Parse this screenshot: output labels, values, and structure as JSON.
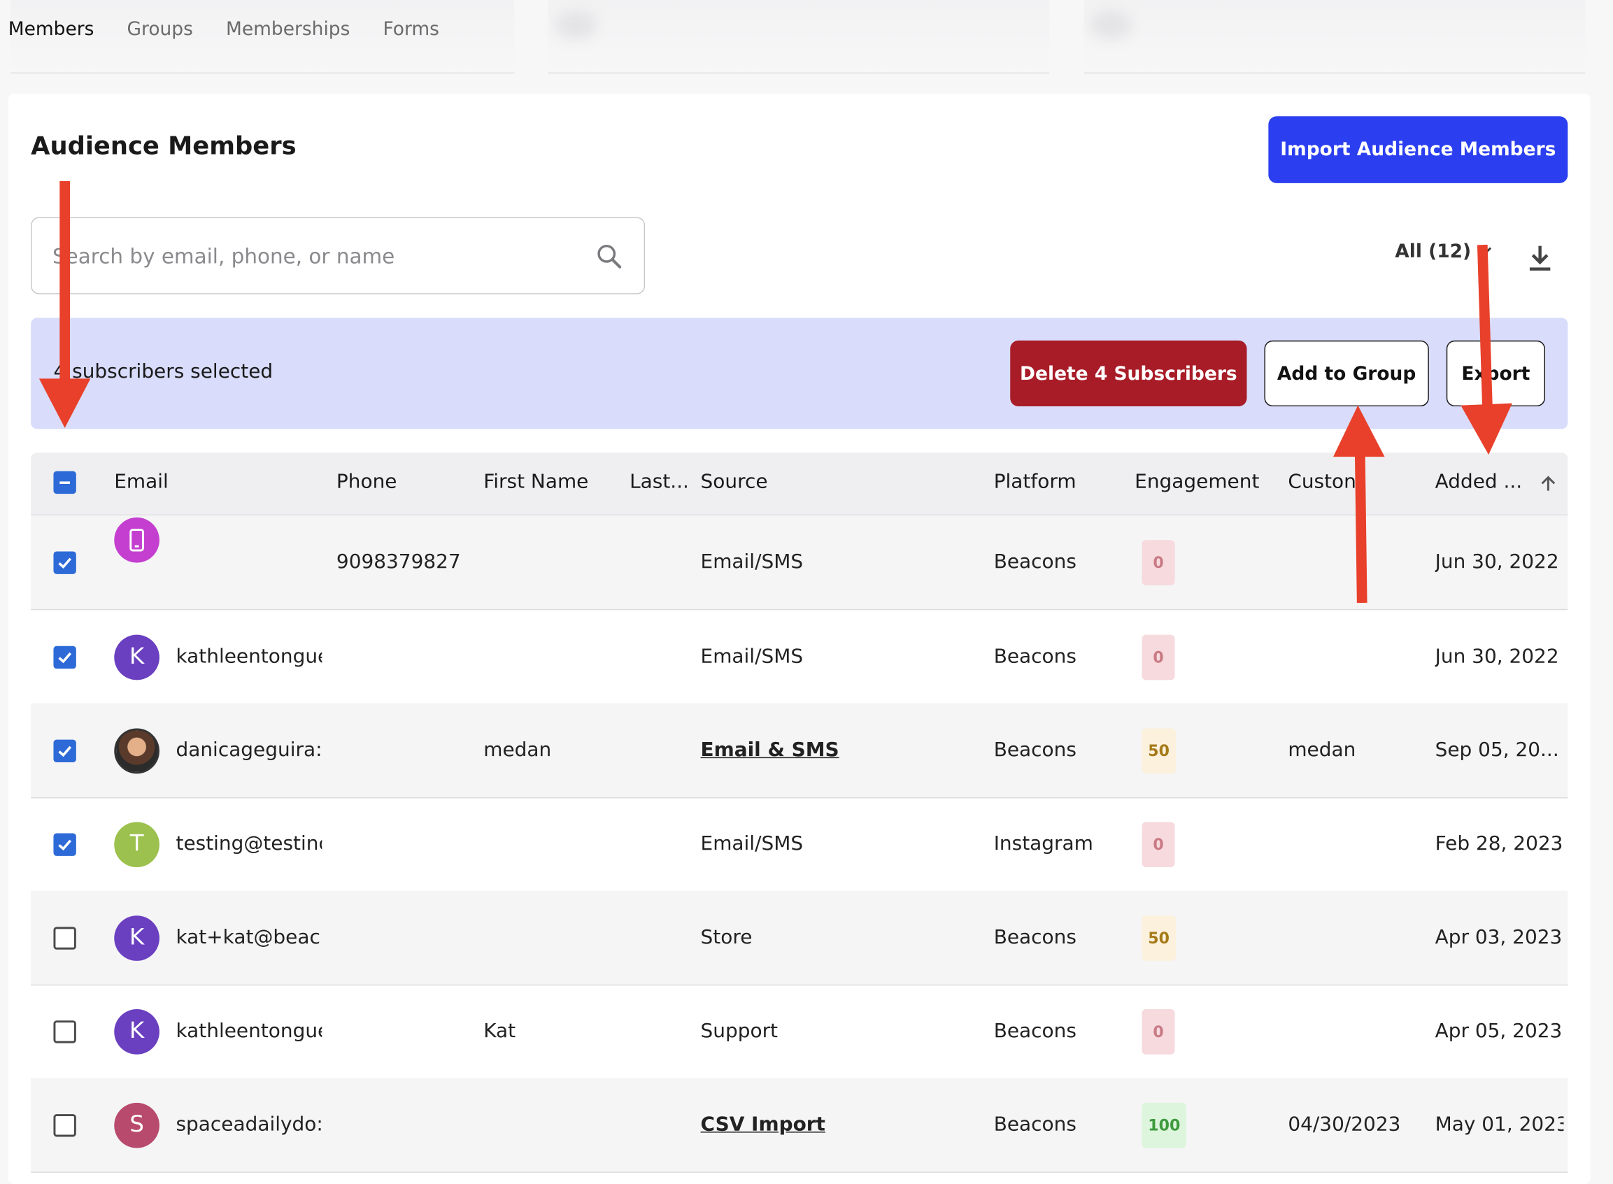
{
  "tabs": [
    {
      "label": "Members",
      "active": true
    },
    {
      "label": "Groups",
      "active": false
    },
    {
      "label": "Memberships",
      "active": false
    },
    {
      "label": "Forms",
      "active": false
    }
  ],
  "header": {
    "title": "Audience Members",
    "import_label": "Import Audience Members"
  },
  "search": {
    "placeholder": "Search by email, phone, or name",
    "value": ""
  },
  "filter": {
    "label": "All (12)"
  },
  "selection": {
    "text": "4 subscribers selected",
    "delete_label": "Delete 4 Subscribers",
    "add_group_label": "Add to Group",
    "export_label": "Export"
  },
  "table": {
    "columns": [
      "Email",
      "Phone",
      "First Name",
      "Last...",
      "Source",
      "Platform",
      "Engagement",
      "Custon",
      "Added ..."
    ],
    "rows": [
      {
        "checked": true,
        "avatar": "",
        "avatar_icon": "phone-icon",
        "avatar_color": "#c43fcf",
        "email": "",
        "phone": "9098379827",
        "first": "",
        "last": "",
        "source": "Email/SMS",
        "source_link": false,
        "platform": "Beacons",
        "engagement": "0",
        "custom": "",
        "added": "Jun 30, 2022"
      },
      {
        "checked": true,
        "avatar": "K",
        "avatar_color": "#6a3fc0",
        "email": "kathleentongue",
        "phone": "",
        "first": "",
        "last": "",
        "source": "Email/SMS",
        "source_link": false,
        "platform": "Beacons",
        "engagement": "0",
        "custom": "",
        "added": "Jun 30, 2022"
      },
      {
        "checked": true,
        "avatar": "",
        "avatar_icon": "profile-photo",
        "avatar_color": "#8a5a3c",
        "email": "danicageguira:",
        "phone": "",
        "first": "medan",
        "last": "",
        "source": "Email & SMS",
        "source_link": true,
        "platform": "Beacons",
        "engagement": "50",
        "custom": "medan",
        "added": "Sep 05, 20..."
      },
      {
        "checked": true,
        "avatar": "T",
        "avatar_color": "#9cc14e",
        "email": "testing@testinc",
        "phone": "",
        "first": "",
        "last": "",
        "source": "Email/SMS",
        "source_link": false,
        "platform": "Instagram",
        "engagement": "0",
        "custom": "",
        "added": "Feb 28, 2023"
      },
      {
        "checked": false,
        "avatar": "K",
        "avatar_color": "#6a3fc0",
        "email": "kat+kat@beac",
        "phone": "",
        "first": "",
        "last": "",
        "source": "Store",
        "source_link": false,
        "platform": "Beacons",
        "engagement": "50",
        "custom": "",
        "added": "Apr 03, 2023"
      },
      {
        "checked": false,
        "avatar": "K",
        "avatar_color": "#6a3fc0",
        "email": "kathleentongue",
        "phone": "",
        "first": "Kat",
        "last": "",
        "source": "Support",
        "source_link": false,
        "platform": "Beacons",
        "engagement": "0",
        "custom": "",
        "added": "Apr 05, 2023"
      },
      {
        "checked": false,
        "avatar": "S",
        "avatar_color": "#b84a6e",
        "email": "spaceadailydo:",
        "phone": "",
        "first": "",
        "last": "",
        "source": "CSV Import",
        "source_link": true,
        "platform": "Beacons",
        "engagement": "100",
        "custom": "04/30/2023",
        "added": "May 01, 2023"
      }
    ]
  },
  "colors": {
    "primary": "#2b3ff0",
    "danger": "#a81c27",
    "selection_bar": "#d9dcfb",
    "checkbox": "#2d6ad7",
    "annotation_arrow": "#e8402a"
  }
}
